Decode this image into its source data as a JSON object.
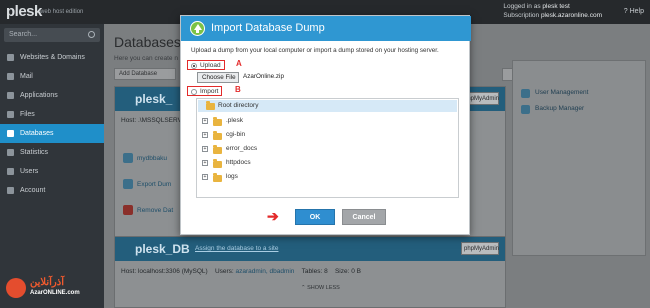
{
  "topbar": {
    "logo": "plesk",
    "edition": "web host edition",
    "logged_in_label": "Logged in as",
    "logged_in_user": "plesk test",
    "subscription_label": "Subscription",
    "subscription_value": "plesk.azaronline.com",
    "help": "Help"
  },
  "sidebar": {
    "search_placeholder": "Search...",
    "items": [
      {
        "label": "Websites & Domains"
      },
      {
        "label": "Mail"
      },
      {
        "label": "Applications"
      },
      {
        "label": "Files"
      },
      {
        "label": "Databases"
      },
      {
        "label": "Statistics"
      },
      {
        "label": "Users"
      },
      {
        "label": "Account"
      }
    ]
  },
  "page": {
    "title": "Databases",
    "hint": "Here you can create n",
    "add_button": "Add Database",
    "db1": {
      "name": "plesk_",
      "host_line": "Host: .\\MSSQLSERV",
      "links": [
        "mydbbaku",
        "Export Dum",
        "Remove Dat"
      ],
      "phpmyadmin": "phpMyAdmin"
    },
    "db2": {
      "name": "plesk_DB",
      "assign": "Assign the database to a site",
      "phpmyadmin": "phpMyAdmin",
      "host": "Host: localhost:3306 (MySQL)",
      "users": "Users:",
      "users_list": "azaradmin, dbadmin",
      "tables": "Tables: 8",
      "size": "Size: 0 B",
      "show_less": "SHOW LESS"
    },
    "right": {
      "user_management": "User Management",
      "backup_manager": "Backup Manager"
    }
  },
  "modal": {
    "title": "Import Database Dump",
    "description": "Upload a dump from your local computer or import a dump stored on your hosting server.",
    "upload_label": "Upload",
    "marker_a": "A",
    "choose_file": "Choose File",
    "chosen_file": "AzarOnline.zip",
    "import_label": "Import",
    "marker_b": "B",
    "tree": {
      "root": "Root directory",
      "folders": [
        ".plesk",
        "cgi-bin",
        "error_docs",
        "httpdocs",
        "logs"
      ]
    },
    "ok": "OK",
    "cancel": "Cancel",
    "arrow": "➔"
  },
  "watermark": {
    "name": "آذرآنلاین",
    "sub": "AzarONLINE.com"
  },
  "colors": {
    "accent": "#2f97d2",
    "annotation_red": "#e32a2a",
    "active_nav": "#1f8fc9"
  }
}
